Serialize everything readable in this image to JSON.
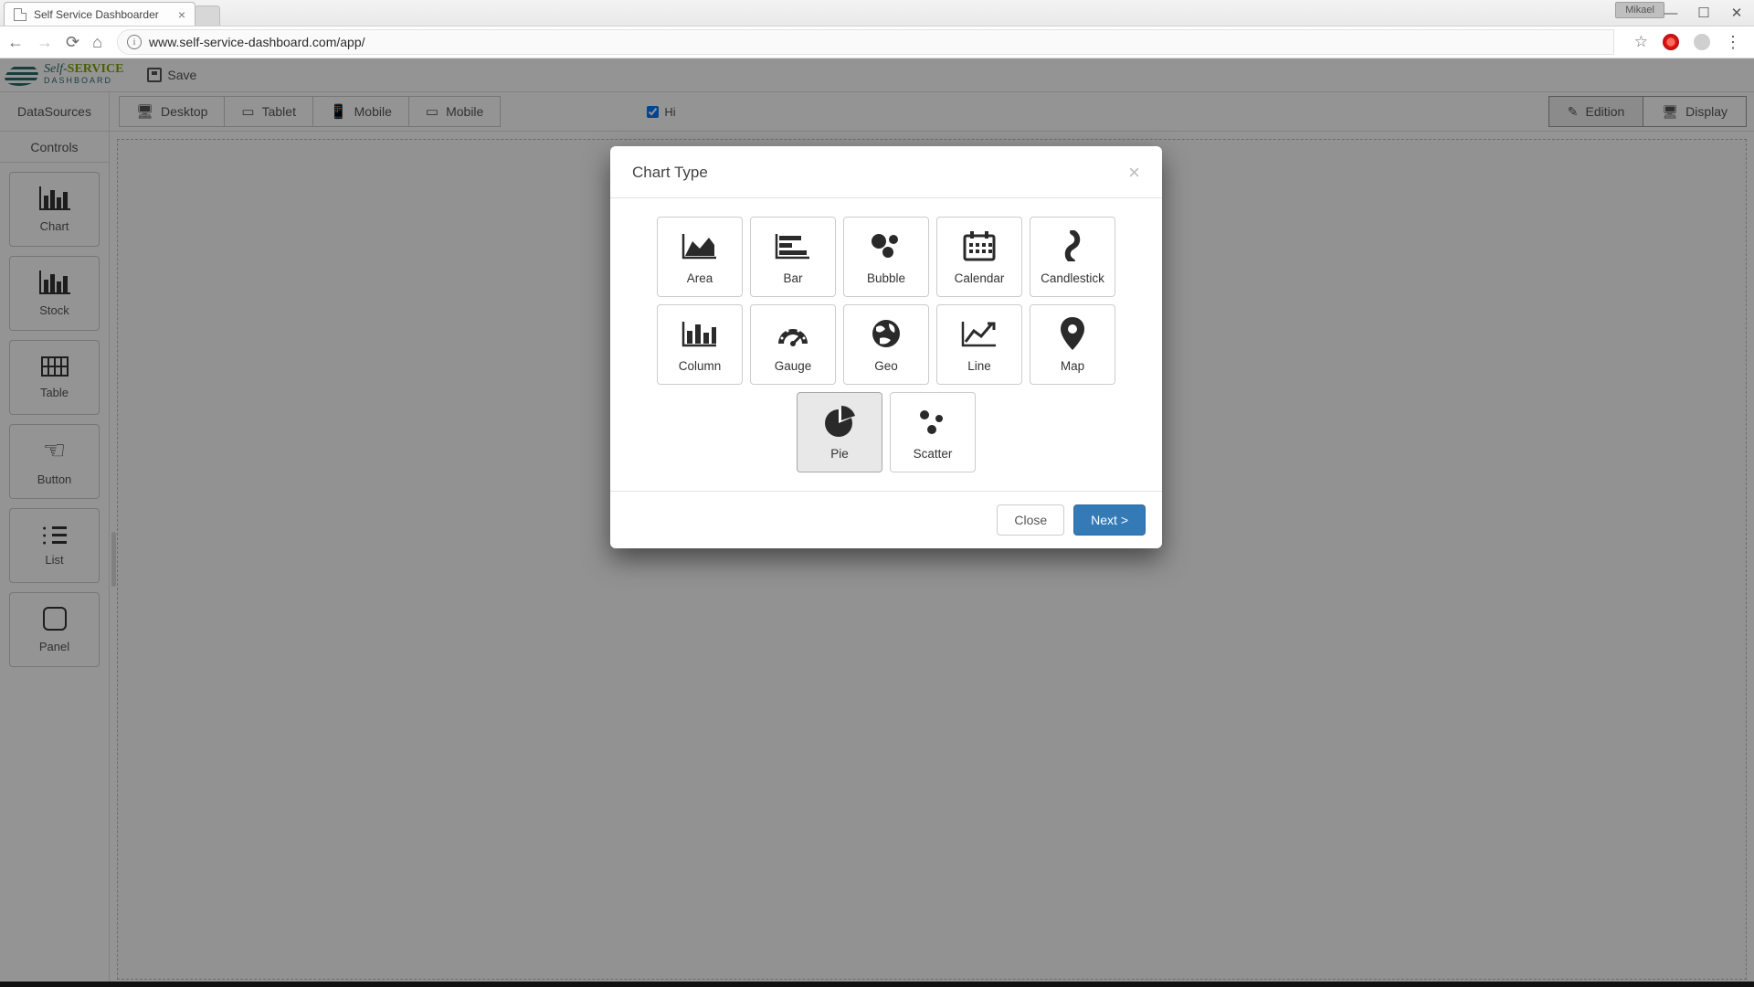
{
  "browser": {
    "tab_title": "Self Service Dashboarder",
    "url": "www.self-service-dashboard.com/app/",
    "user_badge": "Mikael"
  },
  "logo": {
    "word1": "Self-",
    "word2": "SERVICE",
    "word3": "DASHBOARD"
  },
  "toolbar": {
    "save_label": "Save",
    "datasources_label": "DataSources",
    "controls_label": "Controls",
    "hide_label": "Hi",
    "devices": [
      "Desktop",
      "Tablet",
      "Mobile",
      "Mobile"
    ],
    "modes": {
      "edition": "Edition",
      "display": "Display"
    }
  },
  "controls": [
    {
      "icon": "column-chart-icon",
      "label": "Chart"
    },
    {
      "icon": "column-chart-icon",
      "label": "Stock"
    },
    {
      "icon": "table-icon",
      "label": "Table"
    },
    {
      "icon": "pointer-icon",
      "label": "Button"
    },
    {
      "icon": "list-icon",
      "label": "List"
    },
    {
      "icon": "panel-icon",
      "label": "Panel"
    }
  ],
  "modal": {
    "title": "Chart Type",
    "types": [
      {
        "id": "area",
        "label": "Area"
      },
      {
        "id": "bar",
        "label": "Bar"
      },
      {
        "id": "bubble",
        "label": "Bubble"
      },
      {
        "id": "calendar",
        "label": "Calendar"
      },
      {
        "id": "candlestick",
        "label": "Candlestick"
      },
      {
        "id": "column",
        "label": "Column"
      },
      {
        "id": "gauge",
        "label": "Gauge"
      },
      {
        "id": "geo",
        "label": "Geo"
      },
      {
        "id": "line",
        "label": "Line"
      },
      {
        "id": "map",
        "label": "Map"
      },
      {
        "id": "pie",
        "label": "Pie",
        "selected": true
      },
      {
        "id": "scatter",
        "label": "Scatter"
      }
    ],
    "close_label": "Close",
    "next_label": "Next >"
  }
}
